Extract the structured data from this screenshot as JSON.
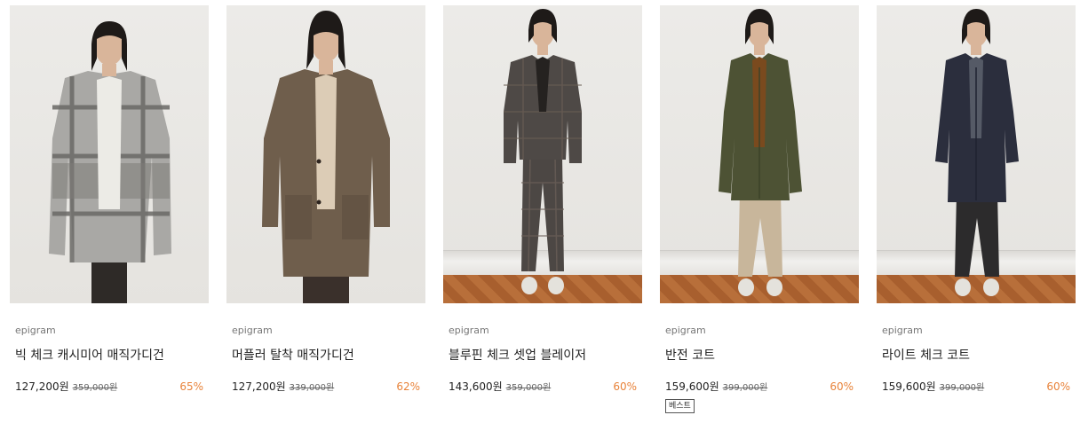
{
  "products": [
    {
      "brand": "epigram",
      "name": "빅 체크 캐시미어 매직가디건",
      "price": "127,200원",
      "original_price": "359,000원",
      "discount": "65%",
      "badge": "",
      "image": "model-in-gray-check-cardigan"
    },
    {
      "brand": "epigram",
      "name": "머플러 탈착 매직가디건",
      "price": "127,200원",
      "original_price": "339,000원",
      "discount": "62%",
      "badge": "",
      "image": "model-in-brown-knit-cardigan"
    },
    {
      "brand": "epigram",
      "name": "블루핀 체크 셋업 블레이저",
      "price": "143,600원",
      "original_price": "359,000원",
      "discount": "60%",
      "badge": "",
      "image": "model-in-check-setup-blazer"
    },
    {
      "brand": "epigram",
      "name": "반전 코트",
      "price": "159,600원",
      "original_price": "399,000원",
      "discount": "60%",
      "badge": "베스트",
      "image": "model-in-khaki-coat"
    },
    {
      "brand": "epigram",
      "name": "라이트 체크 코트",
      "price": "159,600원",
      "original_price": "399,000원",
      "discount": "60%",
      "badge": "",
      "image": "model-in-navy-coat"
    }
  ],
  "colors": {
    "discount": "#e8833a",
    "text": "#222222",
    "brand": "#777777"
  }
}
